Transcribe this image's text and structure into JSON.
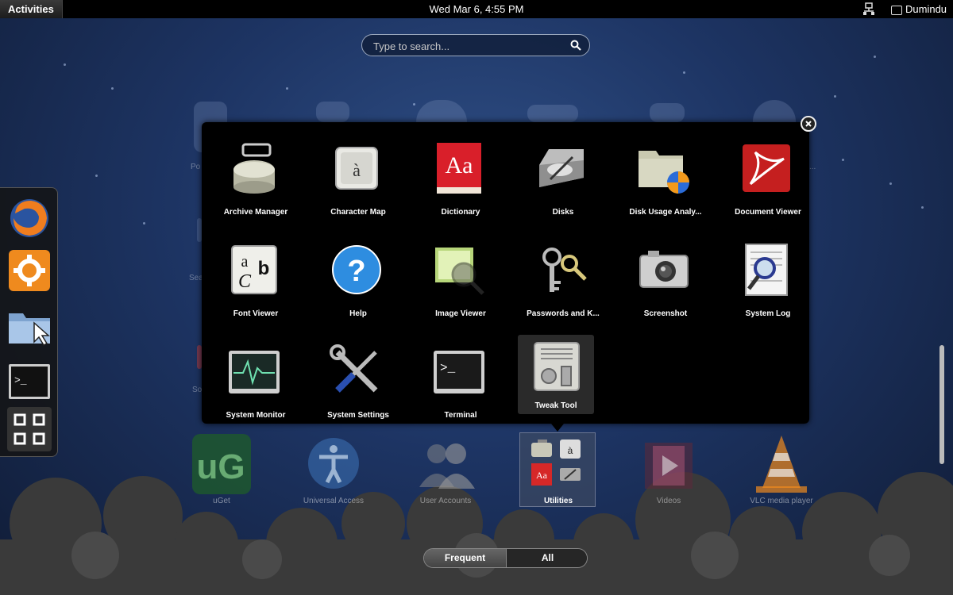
{
  "topbar": {
    "activities": "Activities",
    "clock": "Wed Mar  6,  4:55 PM",
    "user": "Dumindu"
  },
  "search": {
    "placeholder": "Type to search..."
  },
  "utilities_apps": [
    {
      "label": "Archive Manager",
      "icon": "archive-manager-icon"
    },
    {
      "label": "Character Map",
      "icon": "character-map-icon",
      "glyph": "à"
    },
    {
      "label": "Dictionary",
      "icon": "dictionary-icon",
      "glyph": "Aa"
    },
    {
      "label": "Disks",
      "icon": "disks-icon"
    },
    {
      "label": "Disk Usage Analy...",
      "icon": "disk-usage-icon"
    },
    {
      "label": "Document Viewer",
      "icon": "document-viewer-icon"
    },
    {
      "label": "Font Viewer",
      "icon": "font-viewer-icon"
    },
    {
      "label": "Help",
      "icon": "help-icon",
      "glyph": "?"
    },
    {
      "label": "Image Viewer",
      "icon": "image-viewer-icon"
    },
    {
      "label": "Passwords and K...",
      "icon": "passwords-keys-icon"
    },
    {
      "label": "Screenshot",
      "icon": "screenshot-icon"
    },
    {
      "label": "System Log",
      "icon": "system-log-icon"
    },
    {
      "label": "System Monitor",
      "icon": "system-monitor-icon"
    },
    {
      "label": "System Settings",
      "icon": "system-settings-icon"
    },
    {
      "label": "Terminal",
      "icon": "terminal-icon",
      "glyph": ">_"
    },
    {
      "label": "Tweak Tool",
      "icon": "tweak-tool-icon"
    }
  ],
  "bottom_apps": [
    {
      "label": "uGet"
    },
    {
      "label": "Universal Access"
    },
    {
      "label": "User Accounts"
    },
    {
      "label": "Utilities"
    },
    {
      "label": "Videos"
    },
    {
      "label": "VLC media player"
    }
  ],
  "dash": [
    "firefox-icon",
    "settings-gear-icon",
    "files-folder-icon",
    "terminal-icon",
    "show-apps-grid-icon"
  ],
  "bg_labels": {
    "po": "Po",
    "sea": "Sea",
    "so": "So",
    "ellipsis": "..."
  },
  "toggle": {
    "frequent": "Frequent",
    "all": "All"
  },
  "colors": {
    "overlay": "#000000",
    "background": "#1d3463",
    "selected": "#2a2a2a"
  }
}
